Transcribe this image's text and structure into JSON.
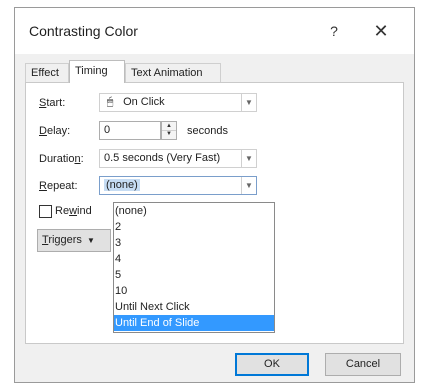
{
  "dialog": {
    "title": "Contrasting Color",
    "help": "?",
    "close": "✕"
  },
  "tabs": [
    {
      "label": "Effect"
    },
    {
      "label": "Timing"
    },
    {
      "label": "Text Animation"
    }
  ],
  "form": {
    "start_label": "Start:",
    "start_value": "On Click",
    "delay_label": "Delay:",
    "delay_value": "0",
    "delay_unit": "seconds",
    "duration_label": "Duration:",
    "duration_value": "0.5 seconds (Very Fast)",
    "repeat_label": "Repeat:",
    "repeat_value": "(none)",
    "rewind_label": "Rewind",
    "triggers_label": "Triggers"
  },
  "repeat_options": [
    "(none)",
    "2",
    "3",
    "4",
    "5",
    "10",
    "Until Next Click",
    "Until End of Slide"
  ],
  "footer": {
    "ok": "OK",
    "cancel": "Cancel"
  },
  "colors": {
    "selection": "#3399ff",
    "accent": "#0078d7"
  }
}
